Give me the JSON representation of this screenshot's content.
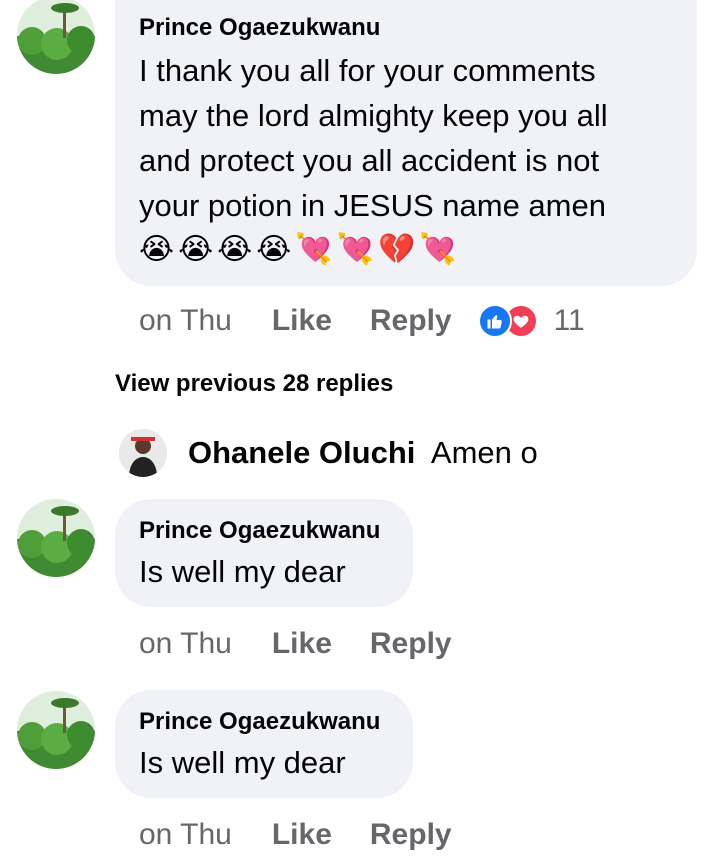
{
  "comments": [
    {
      "author": "Prince Ogaezukwanu",
      "text_lines": [
        "I thank you  all for your  comments",
        "may the lord almighty  keep you all",
        "and  protect  you all accident is  not",
        "your potion in JESUS name amen"
      ],
      "emojis": [
        "😭",
        "😭",
        "😭",
        "😭",
        "💘",
        "💘",
        "💔",
        "💘"
      ],
      "time": "on Thu",
      "like_label": "Like",
      "reply_label": "Reply",
      "reaction_count": "11"
    },
    {
      "author": "Prince Ogaezukwanu",
      "text": "Is well my dear",
      "time": "on Thu",
      "like_label": "Like",
      "reply_label": "Reply"
    },
    {
      "author": "Prince Ogaezukwanu",
      "text": "Is well my dear",
      "time": "on Thu",
      "like_label": "Like",
      "reply_label": "Reply"
    }
  ],
  "view_previous": "View previous 28 replies",
  "collapsed_reply": {
    "author": "Ohanele Oluchi",
    "text": "Amen o"
  },
  "colors": {
    "bubble": "#f0f2f5",
    "meta_text": "#65676b",
    "like_blue": "#1877f2",
    "love_red": "#f33e58"
  }
}
